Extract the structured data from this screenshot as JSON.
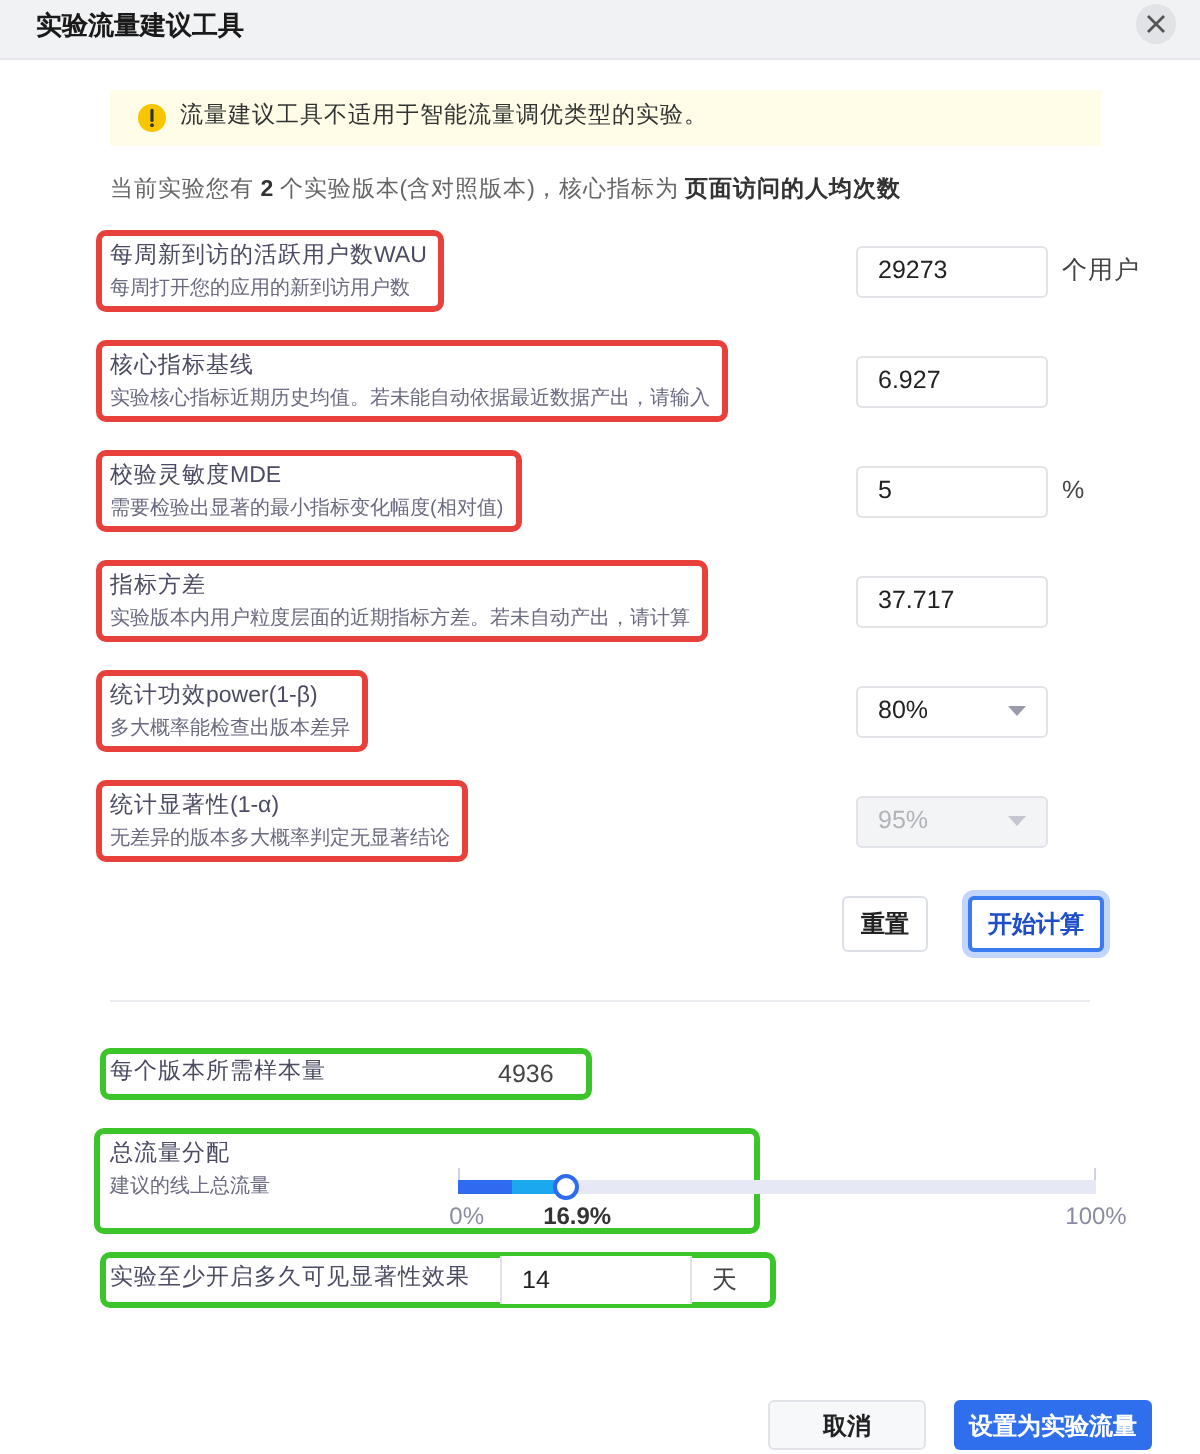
{
  "dialog": {
    "title": "实验流量建议工具"
  },
  "alert": {
    "text": "流量建议工具不适用于智能流量调优类型的实验。"
  },
  "summary": "当前实验您有 **2** 个实验版本(含对照版本)，核心指标为 **页面访问的人均次数**",
  "fields": [
    {
      "kind": "input",
      "label": "每周新到访的活跃用户数WAU",
      "hint": "每周打开您的应用的新到访用户数",
      "value": "29273",
      "unit": "个用户",
      "disabled": false,
      "highlighted": true
    },
    {
      "kind": "input",
      "label": "核心指标基线",
      "hint": "实验核心指标近期历史均值。若未能自动依据最近数据产出，请输入",
      "value": "6.927",
      "disabled": false,
      "highlighted": true
    },
    {
      "kind": "input",
      "label": "校验灵敏度MDE",
      "hint": "需要检验出显著的最小指标变化幅度(相对值)",
      "value": "5",
      "unit": "%",
      "disabled": false,
      "highlighted": true
    },
    {
      "kind": "input",
      "label": "指标方差",
      "hint": "实验版本内用户粒度层面的近期指标方差。若未自动产出，请计算",
      "value": "37.717",
      "disabled": false,
      "highlighted": true
    },
    {
      "kind": "select",
      "label": "统计功效power(1-β)",
      "hint": "多大概率能检查出版本差异",
      "value": "80%",
      "disabled": false,
      "highlighted": true
    },
    {
      "kind": "select",
      "label": "统计显著性(1-α)",
      "hint": "无差异的版本多大概率判定无显著结论",
      "value": "95%",
      "disabled": true,
      "highlighted": true
    }
  ],
  "actions": [
    {
      "label": "重置",
      "kind": "default",
      "focused": false
    },
    {
      "label": "开始计算",
      "kind": "outline",
      "focused": true
    }
  ],
  "results": [
    {
      "kind": "value",
      "label": "每个版本所需样本量",
      "value": "4936",
      "highlighted": true
    },
    {
      "kind": "slider",
      "label": "总流量分配",
      "hint": "建议的线上总流量",
      "level": 0.169,
      "segments": [
        {
          "level": 0.0845,
          "color": "#2f6bf0"
        },
        {
          "level": 0.0845,
          "color": "#1ba8ec"
        }
      ],
      "min_label": "0%",
      "value_label": "16.9%",
      "max_label": "100%",
      "highlighted": true
    },
    {
      "kind": "input",
      "label": "实验至少开启多久可见显著性效果",
      "value": "14",
      "unit": "天",
      "highlighted": true
    }
  ],
  "footer": {
    "buttons": [
      {
        "label": "取消",
        "kind": "default"
      },
      {
        "label": "设置为实验流量",
        "kind": "primary"
      }
    ]
  }
}
